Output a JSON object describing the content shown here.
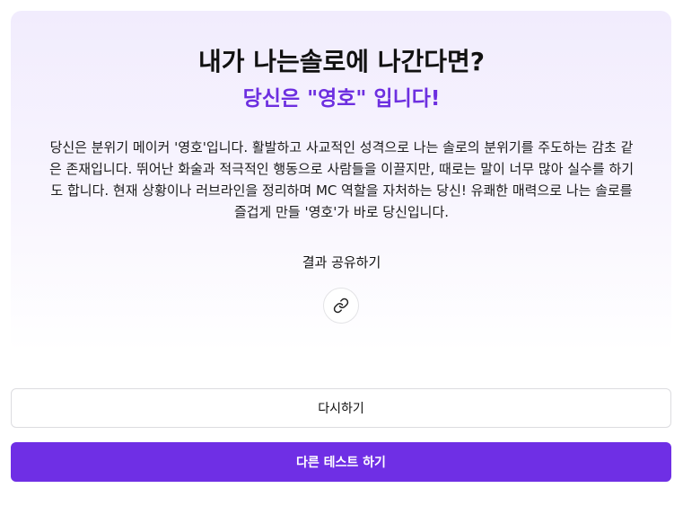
{
  "result": {
    "title": "내가 나는솔로에 나간다면?",
    "subtitle": "당신은 \"영호\" 입니다!",
    "description": "당신은 분위기 메이커 '영호'입니다. 활발하고 사교적인 성격으로 나는 솔로의 분위기를 주도하는 감초 같은 존재입니다. 뛰어난 화술과 적극적인 행동으로 사람들을 이끌지만, 때로는 말이 너무 많아 실수를 하기도 합니다. 현재 상황이나 러브라인을 정리하며 MC 역할을 자처하는 당신! 유쾌한 매력으로 나는 솔로를 즐겁게 만들 '영호'가 바로 당신입니다.",
    "share_label": "결과 공유하기",
    "share_icon": "link-icon"
  },
  "actions": {
    "retry_label": "다시하기",
    "other_test_label": "다른 테스트 하기"
  },
  "colors": {
    "accent": "#6f2fe5",
    "subtitle": "#6d2fe0",
    "card_top": "#f1ecfd"
  }
}
